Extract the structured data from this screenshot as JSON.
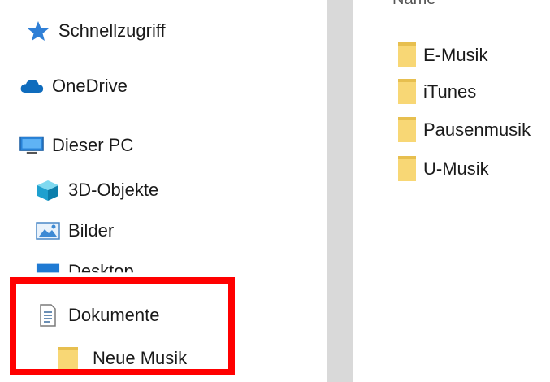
{
  "navigation": {
    "items": [
      {
        "label": "Schnellzugriff",
        "icon": "star-icon"
      },
      {
        "label": "OneDrive",
        "icon": "cloud-icon"
      },
      {
        "label": "Dieser PC",
        "icon": "monitor-icon"
      },
      {
        "label": "3D-Objekte",
        "icon": "cube-icon"
      },
      {
        "label": "Bilder",
        "icon": "pictures-icon"
      },
      {
        "label": "Desktop",
        "icon": "desktop-icon"
      },
      {
        "label": "Dokumente",
        "icon": "document-icon"
      },
      {
        "label": "Neue Musik",
        "icon": "folder-icon"
      }
    ]
  },
  "content": {
    "column_header": "Name",
    "files": [
      {
        "name": "E-Musik",
        "icon": "folder-icon"
      },
      {
        "name": "iTunes",
        "icon": "folder-icon"
      },
      {
        "name": "Pausenmusik",
        "icon": "folder-icon"
      },
      {
        "name": "U-Musik",
        "icon": "folder-icon"
      }
    ]
  },
  "colors": {
    "highlight_border": "#ff0000",
    "folder": "#f8d775",
    "splitter": "#d9d9d9"
  }
}
